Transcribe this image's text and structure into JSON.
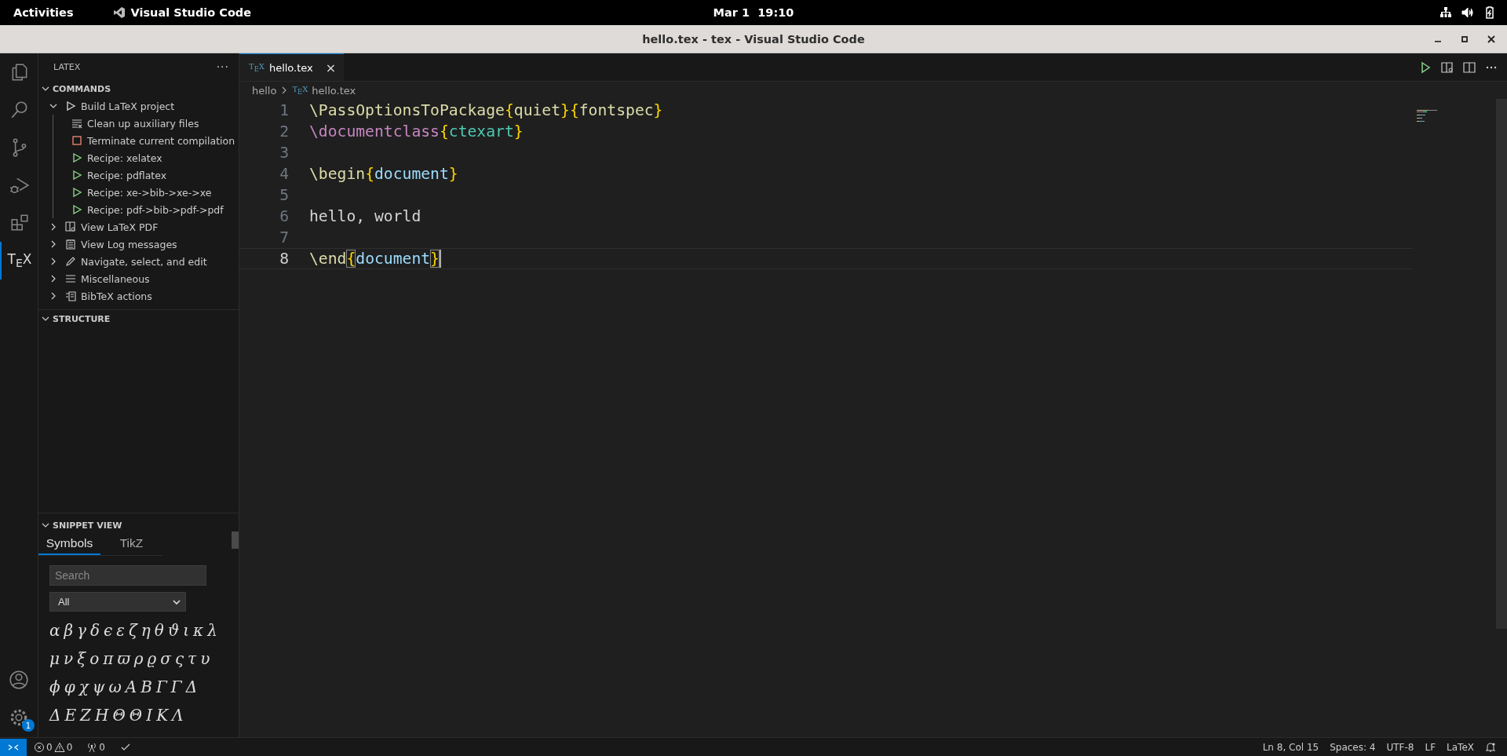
{
  "top_bar": {
    "activities": "Activities",
    "app": "Visual Studio Code",
    "clock": "Mar 1  19:10"
  },
  "window": {
    "title": "hello.tex - tex - Visual Studio Code"
  },
  "activity_bar": {
    "items": [
      {
        "kind": "explorer",
        "selected": false
      },
      {
        "kind": "search",
        "selected": false
      },
      {
        "kind": "source-control",
        "selected": false
      },
      {
        "kind": "run-debug",
        "selected": false
      },
      {
        "kind": "extensions",
        "selected": false
      },
      {
        "kind": "tex",
        "label": "T$_{E}$X",
        "selected": true
      }
    ],
    "settings_badge": "1"
  },
  "sidebar": {
    "title": "LATEX",
    "more": "···",
    "commands": {
      "title": "COMMANDS",
      "expanded": true,
      "items": [
        {
          "label": "Build LaTeX project",
          "kind": "build",
          "expanded": true,
          "children": [
            {
              "label": "Clean up auxiliary files",
              "kind": "clean"
            },
            {
              "label": "Terminate current compilation",
              "kind": "stop"
            },
            {
              "label": "Recipe: xelatex",
              "kind": "recipe"
            },
            {
              "label": "Recipe: pdflatex",
              "kind": "recipe"
            },
            {
              "label": "Recipe: xe->bib->xe->xe",
              "kind": "recipe"
            },
            {
              "label": "Recipe: pdf->bib->pdf->pdf",
              "kind": "recipe"
            }
          ]
        },
        {
          "label": "View LaTeX PDF",
          "kind": "pdf",
          "expanded": false
        },
        {
          "label": "View Log messages",
          "kind": "log",
          "expanded": false
        },
        {
          "label": "Navigate, select, and edit",
          "kind": "edit",
          "expanded": false
        },
        {
          "label": "Miscellaneous",
          "kind": "misc",
          "expanded": false
        },
        {
          "label": "BibTeX actions",
          "kind": "bibtex",
          "expanded": false
        }
      ]
    },
    "structure": {
      "title": "STRUCTURE",
      "expanded": true
    },
    "snippet_view": {
      "title": "SNIPPET VIEW",
      "expanded": true,
      "tabs": [
        {
          "label": "Symbols",
          "selected": true
        },
        {
          "label": "TikZ",
          "selected": false
        }
      ],
      "search": {
        "placeholder": "Search"
      },
      "filter": {
        "value": "All"
      },
      "symbols": [
        [
          "α",
          "β",
          "γ",
          "δ",
          "ϵ",
          "ε",
          "ζ",
          "η",
          "θ",
          "ϑ",
          "ι",
          "κ",
          "λ"
        ],
        [
          "μ",
          "ν",
          "ξ",
          "o",
          "π",
          "ϖ",
          "ρ",
          "ϱ",
          "σ",
          "ς",
          "τ",
          "υ"
        ],
        [
          "ϕ",
          "φ",
          "χ",
          "ψ",
          "ω",
          "A",
          "B",
          "Γ",
          "Γ",
          "Δ"
        ],
        [
          "Δ",
          "E",
          "Z",
          "H",
          "Θ",
          "Θ",
          "I",
          "K",
          "Λ"
        ]
      ]
    }
  },
  "editor": {
    "tabs": [
      {
        "label": "hello.tex",
        "file_icon": "T$_{E}$X",
        "selected": true,
        "close": "×"
      }
    ],
    "breadcrumbs": [
      {
        "label": "hello"
      },
      {
        "label": "hello.tex",
        "file_icon": "T$_{E}$X"
      }
    ],
    "lines": [
      {
        "number": "1",
        "current": false,
        "tokens": [
          {
            "text": "\\PassOptionsToPackage",
            "color": "#dcdcaa",
            "matched": false
          },
          {
            "text": "{",
            "color": "#ffd700",
            "matched": false
          },
          {
            "text": "quiet",
            "color": "#dcdcaa",
            "matched": false
          },
          {
            "text": "}{",
            "color": "#ffd700",
            "matched": false
          },
          {
            "text": "fontspec",
            "color": "#dcdcaa",
            "matched": false
          },
          {
            "text": "}",
            "color": "#ffd700",
            "matched": false
          }
        ]
      },
      {
        "number": "2",
        "current": false,
        "tokens": [
          {
            "text": "\\documentclass",
            "color": "#c586c0",
            "matched": false
          },
          {
            "text": "{",
            "color": "#ffd700",
            "matched": false
          },
          {
            "text": "ctexart",
            "color": "#4ec9b0",
            "matched": false
          },
          {
            "text": "}",
            "color": "#ffd700",
            "matched": false
          }
        ]
      },
      {
        "number": "3",
        "current": false
      },
      {
        "number": "4",
        "current": false,
        "tokens": [
          {
            "text": "\\begin",
            "color": "#dcdcaa",
            "matched": false
          },
          {
            "text": "{",
            "color": "#ffd700",
            "matched": false
          },
          {
            "text": "document",
            "color": "#9cdcfe",
            "matched": false
          },
          {
            "text": "}",
            "color": "#ffd700",
            "matched": false
          }
        ]
      },
      {
        "number": "5",
        "current": false
      },
      {
        "number": "6",
        "current": false,
        "tokens": [
          {
            "text": "hello, world",
            "color": "#d4d4d4",
            "matched": false
          }
        ]
      },
      {
        "number": "7",
        "current": false
      },
      {
        "number": "8",
        "current": true,
        "tokens": [
          {
            "text": "\\end",
            "color": "#dcdcaa",
            "matched": false
          },
          {
            "text": "{",
            "color": "#ffd700",
            "matched": true
          },
          {
            "text": "document",
            "color": "#9cdcfe",
            "matched": false
          },
          {
            "text": "}",
            "color": "#ffd700",
            "matched": true
          }
        ]
      }
    ]
  },
  "status_bar": {
    "errors": "0",
    "warnings": "0",
    "ports": "0",
    "right": [
      "Ln 8, Col 15",
      "Spaces: 4",
      "UTF-8",
      "LF",
      "LaTeX"
    ]
  }
}
